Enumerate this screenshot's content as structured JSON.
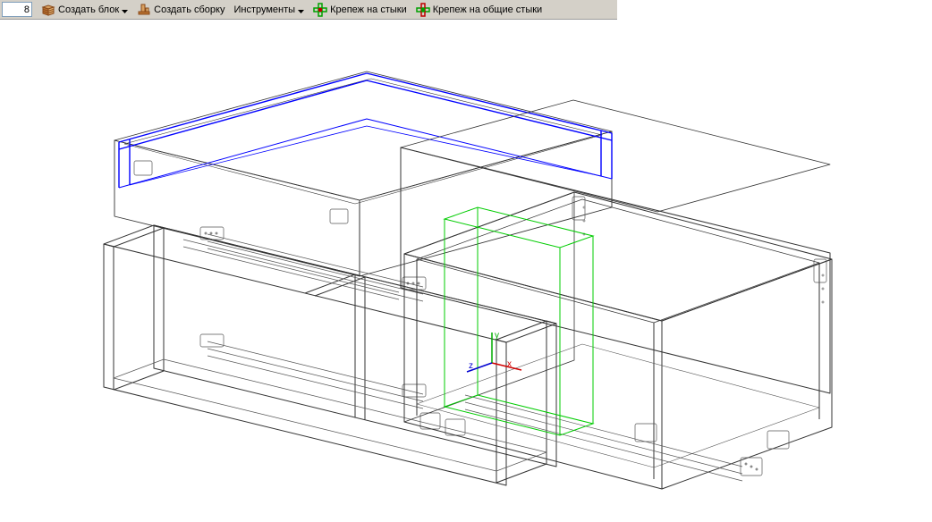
{
  "toolbar": {
    "input_value": "8",
    "create_block_label": "Создать блок",
    "create_assembly_label": "Создать сборку",
    "tools_label": "Инструменты",
    "fastener_joints_label": "Крепеж на стыки",
    "fastener_shared_joints_label": "Крепеж на общие стыки"
  },
  "scene": {
    "axis_x_label": "x",
    "axis_y_label": "y",
    "axis_z_label": "z",
    "colors": {
      "selected": "#0000ff",
      "wire": "#333333",
      "helper": "#00cc00",
      "axis_x": "#d00000",
      "axis_y": "#00aa00",
      "axis_z": "#0000d0"
    }
  }
}
